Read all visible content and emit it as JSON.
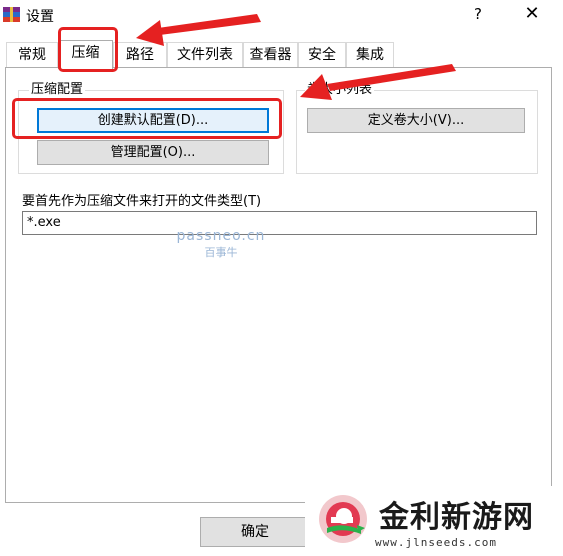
{
  "window": {
    "title": "设置",
    "help_glyph": "?",
    "close_glyph": "✕",
    "icon": "winrar-books-icon"
  },
  "tabs": [
    {
      "label": "常规",
      "active": false
    },
    {
      "label": "压缩",
      "active": true
    },
    {
      "label": "路径",
      "active": false
    },
    {
      "label": "文件列表",
      "active": false
    },
    {
      "label": "查看器",
      "active": false
    },
    {
      "label": "安全",
      "active": false
    },
    {
      "label": "集成",
      "active": false
    }
  ],
  "compression_profiles": {
    "group_label": "压缩配置",
    "create_default_button": "创建默认配置(D)...",
    "manage_button": "管理配置(O)..."
  },
  "volume_sizes": {
    "group_label": "卷大小列表",
    "define_button": "定义卷大小(V)..."
  },
  "archive_types": {
    "label": "要首先作为压缩文件来打开的文件类型(T)",
    "value": "*.exe"
  },
  "footer": {
    "ok_button": "确定"
  },
  "watermark": {
    "line1": "passneo.cn",
    "line2": "百事牛"
  },
  "logo": {
    "title": "金利新游网",
    "url": "www.jlnseeds.com"
  },
  "annotation_color": "#e52121"
}
